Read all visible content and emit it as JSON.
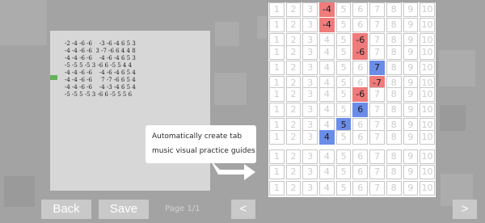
{
  "tab_sheet": {
    "lines": [
      "-2 -4 -6 -6    -3 -6 -4 6 5 3",
      "-4 -4 -6 -6  3 -7 -6 6 4 4 8",
      "-4 -4 -6 -6    -4 -6 -4 6 5 3",
      "-5 -5 5 -5 3 -6 6 -5 5 4 4",
      "-4 -4 -6 -6    -4 -6 -4 6 5 4",
      "-4 -4 -6 -6     7 -7 -6 6 5 4",
      "-4 -4 -6 -6    -4 -3 -4 6 5 4",
      "-5 -5 5 -5 3 -6 6 -5 5 5 6"
    ]
  },
  "grid": {
    "rows": [
      {
        "highlight_col": 3,
        "highlight_label": "-4",
        "highlight_color": "#ef7b7b"
      },
      {
        "highlight_col": 3,
        "highlight_label": "-4",
        "highlight_color": "#ef7b7b"
      },
      {
        "highlight_col": 5,
        "highlight_label": "-6",
        "highlight_color": "#ef7b7b"
      },
      {
        "highlight_col": 5,
        "highlight_label": "-6",
        "highlight_color": "#ef7b7b"
      },
      {
        "highlight_col": 6,
        "highlight_label": "7",
        "highlight_color": "#6b8de8"
      },
      {
        "highlight_col": 6,
        "highlight_label": "-7",
        "highlight_color": "#ef7b7b"
      },
      {
        "highlight_col": 5,
        "highlight_label": "-6",
        "highlight_color": "#ef7b7b"
      },
      {
        "highlight_col": 5,
        "highlight_label": "6",
        "highlight_color": "#6b8de8"
      },
      {
        "highlight_col": 4,
        "highlight_label": "5",
        "highlight_color": "#6b8de8"
      },
      {
        "highlight_col": 3,
        "highlight_label": "4",
        "highlight_color": "#6b8de8"
      },
      {
        "highlight_col": null
      },
      {
        "highlight_col": null
      },
      {
        "highlight_col": null
      }
    ],
    "column_labels": [
      "1",
      "2",
      "3",
      "4",
      "5",
      "6",
      "7",
      "8",
      "9",
      "10"
    ]
  },
  "callout": {
    "line1": "Automatically create tab",
    "line2": "music visual practice guides"
  },
  "buttons": {
    "back": "Back",
    "save": "Save",
    "prev": "<",
    "next": ">"
  },
  "page_indicator": "Page 1/1",
  "colors": {
    "highlight_draw": "#ef7b7b",
    "highlight_blow": "#6b8de8",
    "background": "#a3a3a3"
  }
}
